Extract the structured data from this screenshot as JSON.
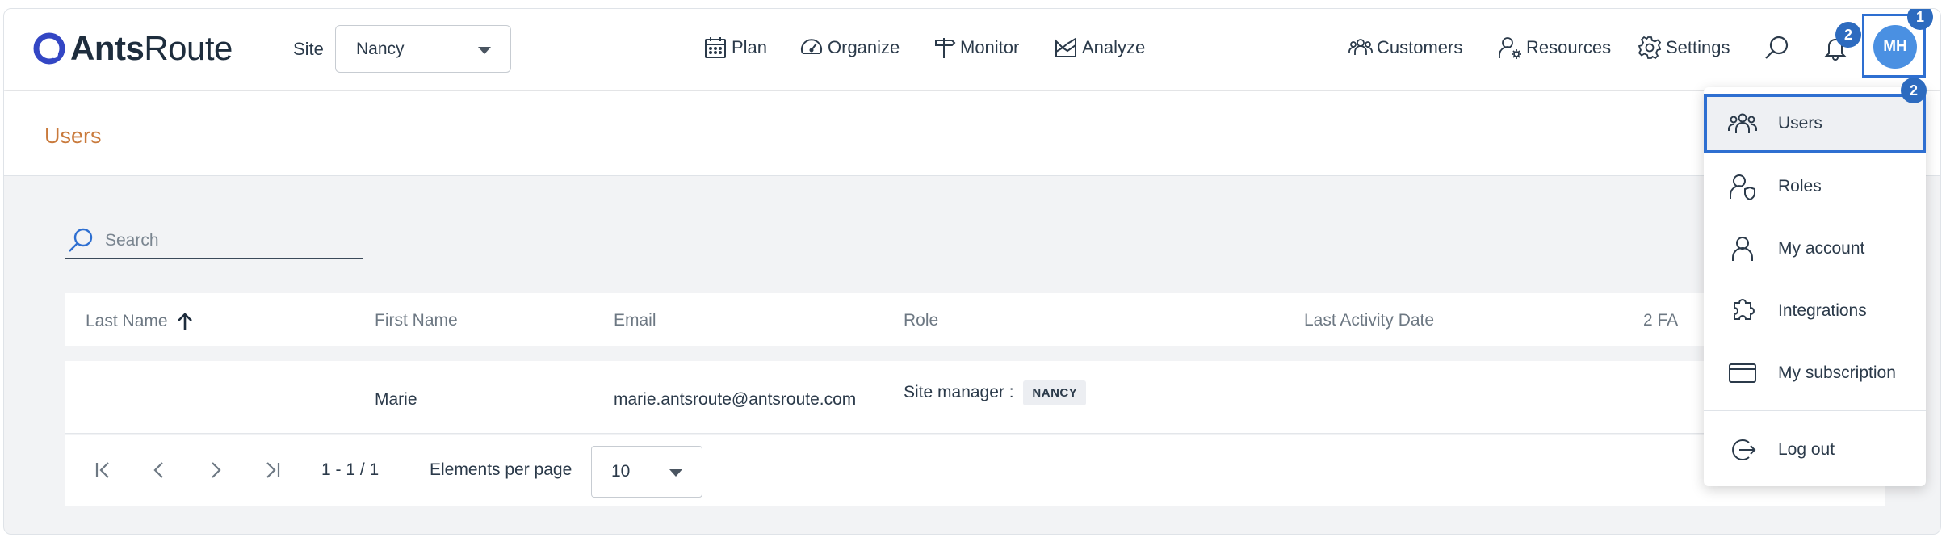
{
  "brand": {
    "name_bold": "Ants",
    "name_regular": "Route"
  },
  "site": {
    "label": "Site",
    "selected": "Nancy"
  },
  "nav": {
    "plan": "Plan",
    "organize": "Organize",
    "monitor": "Monitor",
    "analyze": "Analyze",
    "customers": "Customers",
    "resources": "Resources",
    "settings": "Settings"
  },
  "notifications": {
    "count": "2"
  },
  "user": {
    "initials": "MH"
  },
  "step_markers": {
    "avatar": "1",
    "menu_users": "2"
  },
  "page": {
    "title": "Users"
  },
  "search": {
    "placeholder": "Search",
    "value": ""
  },
  "table": {
    "columns": [
      "Last Name",
      "First Name",
      "Email",
      "Role",
      "Last Activity Date",
      "2 FA"
    ],
    "sort": {
      "column": "Last Name",
      "direction": "asc"
    },
    "rows": [
      {
        "last_name": "",
        "first_name": "Marie",
        "email": "marie.antsroute@antsroute.com",
        "role": "Site manager :",
        "role_site": "NANCY",
        "last_activity": "",
        "two_fa": ""
      }
    ]
  },
  "pagination": {
    "range": "1 - 1 / 1",
    "per_page_label": "Elements per page",
    "per_page": "10"
  },
  "menu": {
    "items": [
      {
        "label": "Users",
        "icon": "users-icon",
        "active": true
      },
      {
        "label": "Roles",
        "icon": "roles-icon",
        "active": false
      },
      {
        "label": "My account",
        "icon": "account-icon",
        "active": false
      },
      {
        "label": "Integrations",
        "icon": "integrations-icon",
        "active": false
      },
      {
        "label": "My subscription",
        "icon": "subscription-icon",
        "active": false
      },
      {
        "label": "Log out",
        "icon": "logout-icon",
        "active": false
      }
    ]
  },
  "colors": {
    "accent": "#2e6fd1",
    "avatar": "#4a90e2",
    "title": "#c97a3c",
    "badge": "#2d6bbf",
    "logo": "#3346c4"
  }
}
